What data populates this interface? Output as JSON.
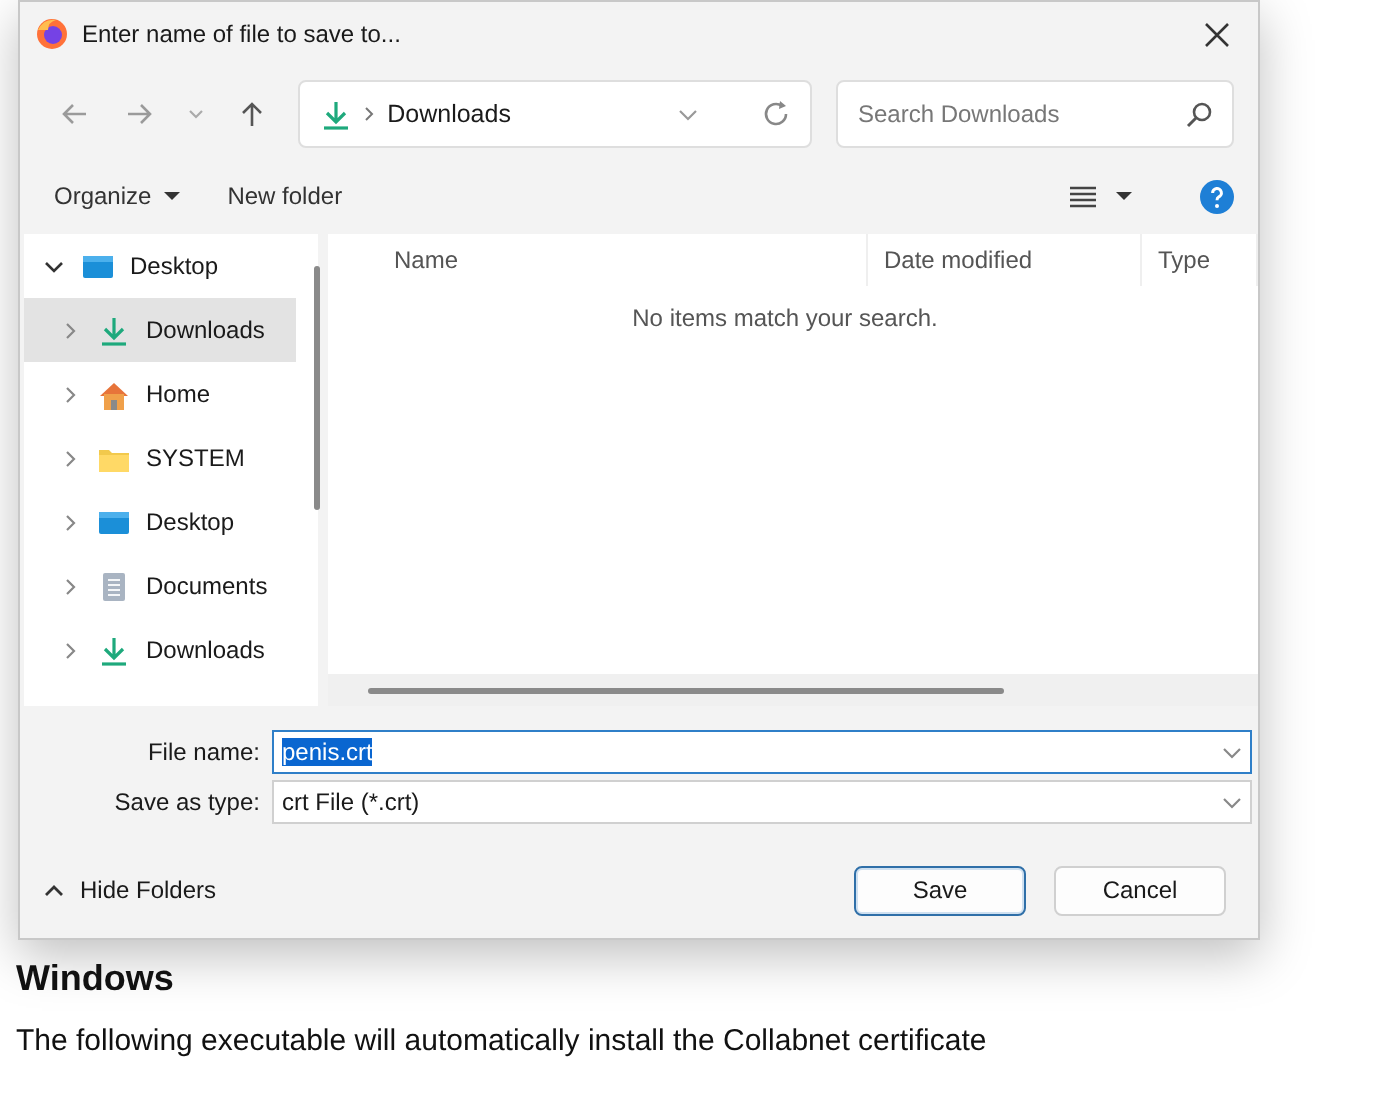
{
  "dialog": {
    "title": "Enter name of file to save to...",
    "address": {
      "location": "Downloads"
    },
    "search": {
      "placeholder": "Search Downloads"
    },
    "toolbar": {
      "organize": "Organize",
      "new_folder": "New folder"
    },
    "tree": [
      {
        "label": "Desktop",
        "kind": "desktop",
        "expanded": true,
        "selected": false,
        "children": [
          {
            "label": "Downloads",
            "kind": "download",
            "expanded": false,
            "selected": true
          },
          {
            "label": "Home",
            "kind": "home",
            "expanded": false,
            "selected": false
          },
          {
            "label": "SYSTEM",
            "kind": "folder",
            "expanded": false,
            "selected": false
          },
          {
            "label": "Desktop",
            "kind": "desktop",
            "expanded": false,
            "selected": false
          },
          {
            "label": "Documents",
            "kind": "documents",
            "expanded": false,
            "selected": false
          },
          {
            "label": "Downloads",
            "kind": "download",
            "expanded": false,
            "selected": false
          }
        ]
      }
    ],
    "columns": [
      "Name",
      "Date modified",
      "Type"
    ],
    "empty_message": "No items match your search.",
    "file_name": {
      "label": "File name:",
      "value": "penis.crt",
      "value_selected": true
    },
    "save_type": {
      "label": "Save as type:",
      "value": "crt File (*.crt)"
    },
    "hide_folders": "Hide Folders",
    "buttons": [
      {
        "label": "Save",
        "default": true
      },
      {
        "label": "Cancel",
        "default": false
      }
    ]
  },
  "page": {
    "heading": "Windows",
    "paragraph": "The following executable will automatically install the Collabnet certificate"
  }
}
